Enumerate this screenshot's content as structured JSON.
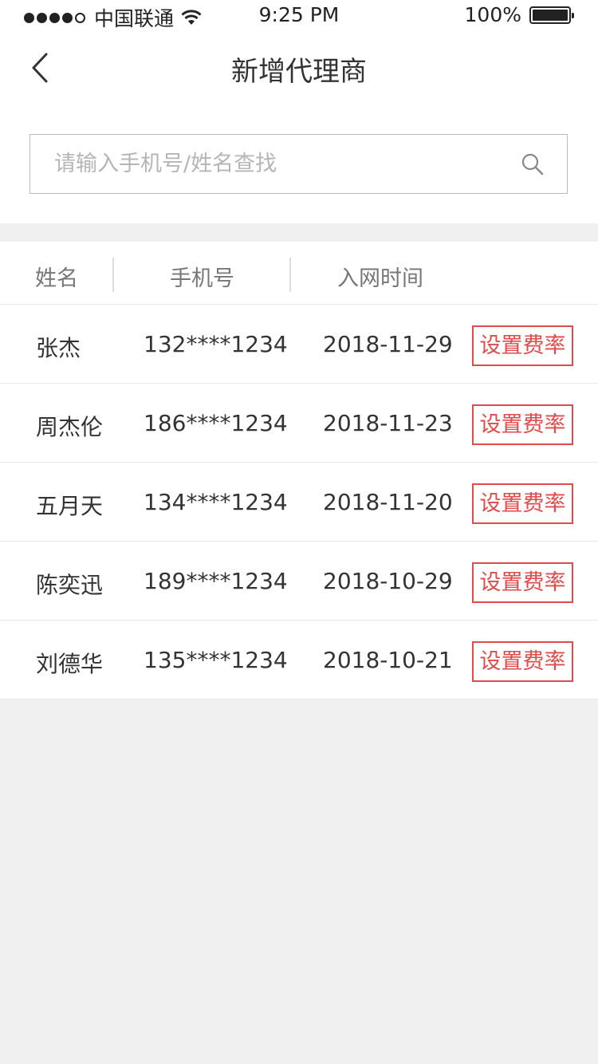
{
  "status_bar": {
    "carrier": "中国联通",
    "time": "9:25 PM",
    "battery": "100%"
  },
  "nav": {
    "title": "新增代理商"
  },
  "search": {
    "placeholder": "请输入手机号/姓名查找",
    "value": ""
  },
  "table": {
    "headers": [
      "姓名",
      "手机号",
      "入网时间"
    ],
    "rows": [
      {
        "name": "张杰",
        "phone": "132****1234",
        "date": "2018-11-29",
        "action": "设置费率"
      },
      {
        "name": "周杰伦",
        "phone": "186****1234",
        "date": "2018-11-23",
        "action": "设置费率"
      },
      {
        "name": "五月天",
        "phone": "134****1234",
        "date": "2018-11-20",
        "action": "设置费率"
      },
      {
        "name": "陈奕迅",
        "phone": "189****1234",
        "date": "2018-10-29",
        "action": "设置费率"
      },
      {
        "name": "刘德华",
        "phone": "135****1234",
        "date": "2018-10-21",
        "action": "设置费率"
      }
    ]
  },
  "colors": {
    "accent": "#e04b4b",
    "background": "#f0f0f0"
  }
}
